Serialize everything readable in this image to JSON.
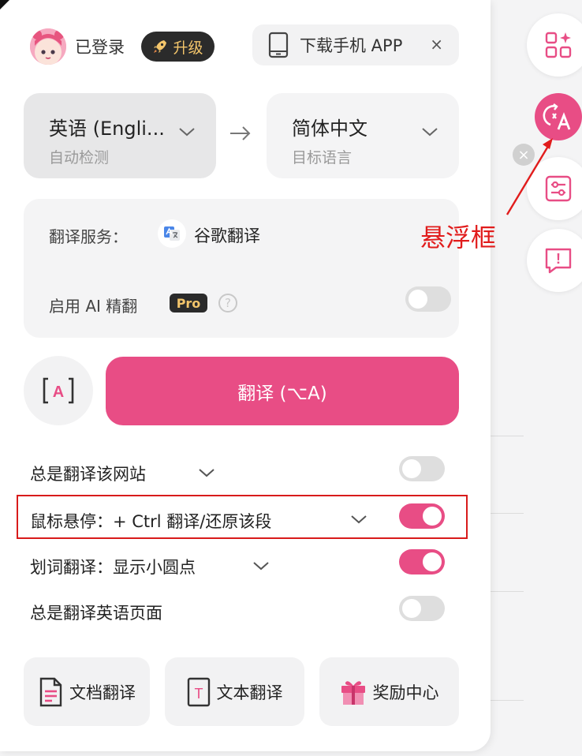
{
  "header": {
    "login_status": "已登录",
    "upgrade_label": "升级",
    "app_download_label": "下载手机 APP",
    "close_symbol": "×"
  },
  "languages": {
    "source": {
      "name": "英语 (Engli...",
      "hint": "自动检测"
    },
    "target": {
      "name": "简体中文",
      "hint": "目标语言"
    }
  },
  "service": {
    "label": "翻译服务：",
    "provider": "谷歌翻译",
    "ai_label": "启用 AI 精翻",
    "pro_badge": "Pro",
    "help_symbol": "?",
    "ai_enabled": false
  },
  "translate": {
    "read_icon_letter": "A",
    "button_label": "翻译 (⌥A)"
  },
  "options": [
    {
      "label": "总是翻译该网站",
      "enabled": false
    },
    {
      "label": "鼠标悬停：+ Ctrl 翻译/还原该段",
      "enabled": true
    },
    {
      "label": "划词翻译：显示小圆点",
      "enabled": true
    },
    {
      "label": "总是翻译英语页面",
      "enabled": false
    }
  ],
  "bottom_buttons": [
    {
      "label": "文档翻译",
      "icon": "document-icon"
    },
    {
      "label": "文本翻译",
      "icon": "text-icon",
      "icon_letter": "T"
    },
    {
      "label": "奖励中心",
      "icon": "gift-icon"
    }
  ],
  "floating_bar": {
    "close_symbol": "×",
    "exclaim_symbol": "!",
    "annotation_label": "悬浮框",
    "icons": [
      "apps-sparkle-icon",
      "translate-icon",
      "settings-sliders-icon",
      "feedback-icon"
    ]
  },
  "colors": {
    "accent": "#e84d85",
    "annotation": "#e11c1c",
    "badge_text": "#f3c56b",
    "badge_bg": "#2b2b2b"
  }
}
